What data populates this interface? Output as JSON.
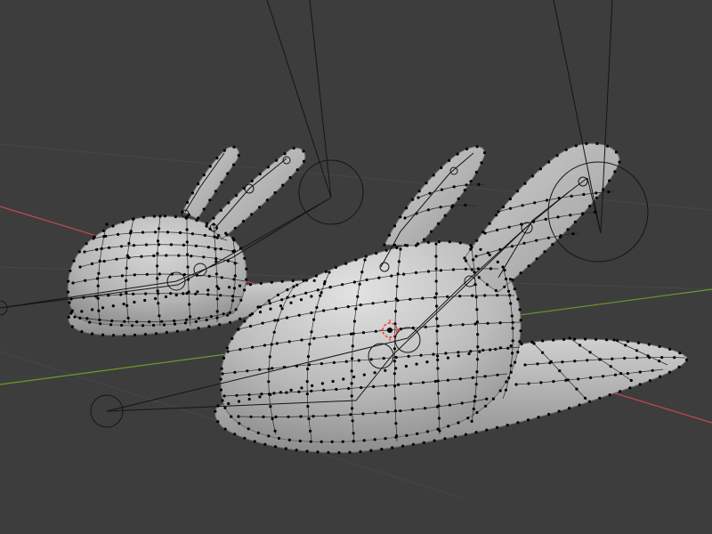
{
  "viewport": {
    "background": "#3d3d3d",
    "grid_line_color": "#474747",
    "x_axis_color": "#c7484f",
    "y_axis_color": "#6d9a2a",
    "mesh_color": "#bdbdbd",
    "mesh_shadow_color": "#7e7e7e",
    "wire_color": "#1a1a1a",
    "vertex_color": "#000000",
    "origin_color": "#e8423a"
  },
  "scene_objects": [
    {
      "kind": "slipper-mesh",
      "name": "slipper-left",
      "in_edit_mode": true
    },
    {
      "kind": "slipper-mesh",
      "name": "slipper-right",
      "in_edit_mode": true
    },
    {
      "kind": "armature-bones",
      "name": "bone-chain"
    },
    {
      "kind": "control-empties",
      "name": "circle-controls"
    },
    {
      "kind": "origin-marker",
      "name": "3d-cursor"
    }
  ]
}
